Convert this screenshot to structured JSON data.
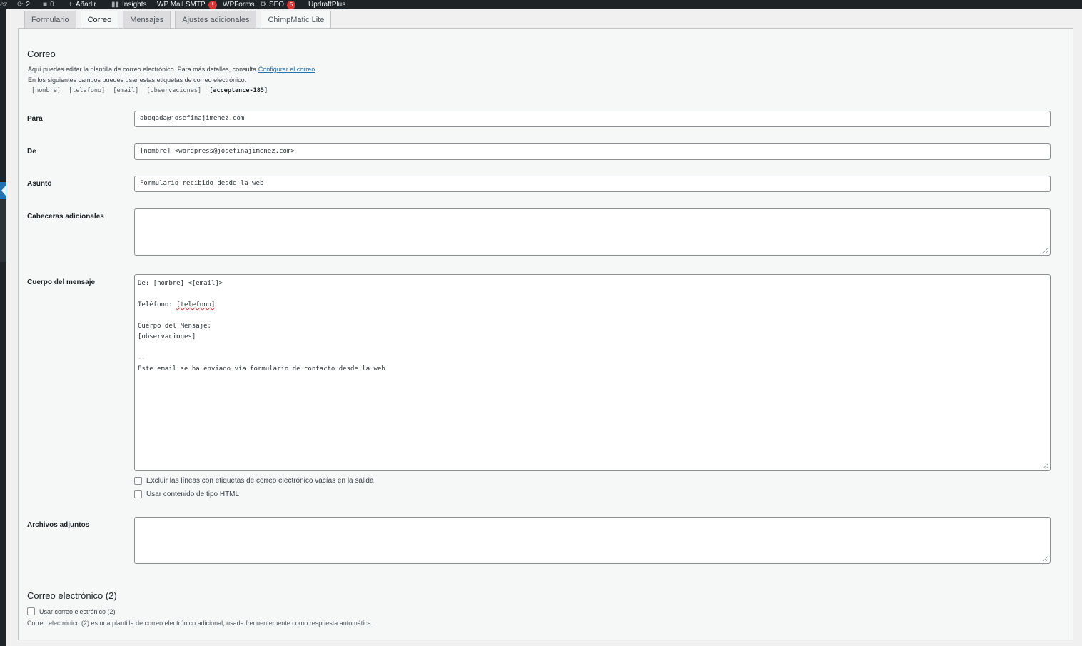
{
  "admin_bar": {
    "site_fragment": "ez",
    "updates_count": "2",
    "comments_count": "0",
    "add_new": "Añadir",
    "insights": "Insights",
    "wp_mail_smtp": "WP Mail SMTP",
    "wp_mail_smtp_badge": "!",
    "wpforms": "WPForms",
    "seo": "SEO",
    "seo_badge": "5",
    "updraftplus": "UpdraftPlus"
  },
  "tabs": [
    {
      "label": "Formulario"
    },
    {
      "label": "Correo"
    },
    {
      "label": "Mensajes"
    },
    {
      "label": "Ajustes adicionales"
    },
    {
      "label": "ChimpMatic Lite"
    }
  ],
  "mail": {
    "title": "Correo",
    "description_prefix": "Aquí puedes editar la plantilla de correo electrónico. Para más detalles, consulta",
    "description_link": "Configurar el correo",
    "description_suffix": ".",
    "tags_intro": "En los siguientes campos puedes usar estas etiquetas de correo electrónico:",
    "tags": [
      "[nombre]",
      "[telefono]",
      "[email]",
      "[observaciones]"
    ],
    "tag_bold": "[acceptance-185]",
    "fields": {
      "to_label": "Para",
      "to_value": "abogada@josefinajimenez.com",
      "from_label": "De",
      "from_value": "[nombre] <wordpress@josefinajimenez.com>",
      "subject_label": "Asunto",
      "subject_value": "Formulario recibido desde la web",
      "headers_label": "Cabeceras adicionales",
      "headers_value": "",
      "body_label": "Cuerpo del mensaje",
      "body_lines": [
        "De: [nombre] <[email]>",
        "",
        "Teléfono: ",
        "",
        "Cuerpo del Mensaje:",
        "[observaciones]",
        "",
        "--",
        "Este email se ha enviado vía formulario de contacto desde la web"
      ],
      "body_underlined": "[telefono]",
      "exclude_blank_label": "Excluir las líneas con etiquetas de correo electrónico vacías en la salida",
      "use_html_label": "Usar contenido de tipo HTML",
      "attachments_label": "Archivos adjuntos",
      "attachments_value": ""
    }
  },
  "mail2": {
    "title": "Correo electrónico (2)",
    "checkbox_label": "Usar correo electrónico (2)",
    "description": "Correo electrónico (2) es una plantilla de correo electrónico adicional, usada frecuentemente como respuesta automática."
  },
  "colors": {
    "admin_bar_bg": "#1d2327",
    "link": "#2271b1",
    "badge": "#d63638"
  }
}
